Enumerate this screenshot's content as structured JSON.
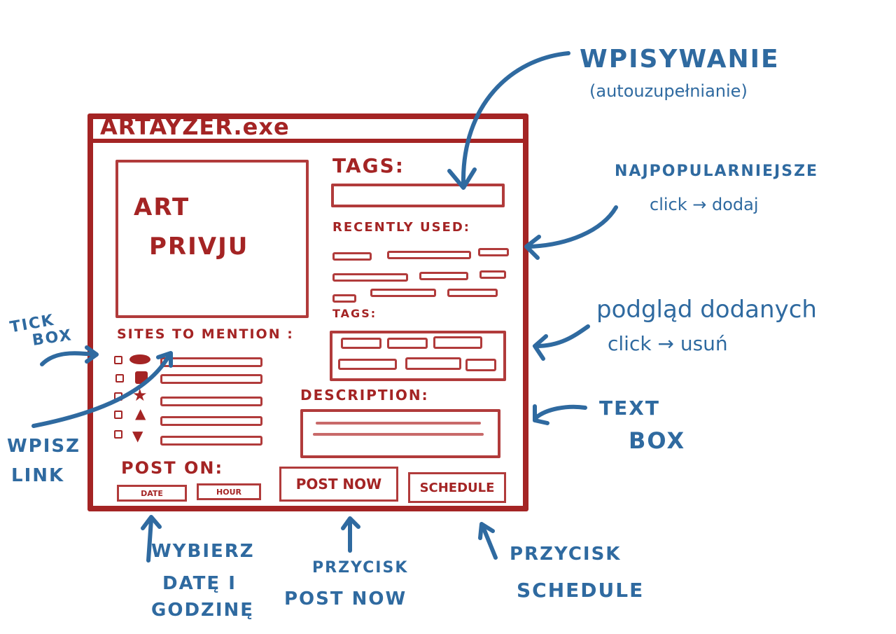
{
  "window": {
    "title": "ARTAYZER.exe",
    "preview_text": [
      "ART",
      "PRIVJU"
    ],
    "tags_label": "TAGS:",
    "recently_used_label": "RECENTLY USED:",
    "tags_selected_label": "TAGS:",
    "sites_label": "SITES TO MENTION :",
    "description_label": "DESCRIPTION:",
    "post_on_label": "POST ON:",
    "date_button": "DATE",
    "hour_button": "HOUR",
    "post_now_button": "POST NOW",
    "schedule_button": "SCHEDULE",
    "site_icons": [
      "circle",
      "square",
      "star",
      "triangle-up",
      "triangle-down"
    ]
  },
  "annotations": {
    "wpisywanie": {
      "title": "WPISYWANIE",
      "sub": "(autouzupełnianie)"
    },
    "najpopularniejsze": [
      "NAJPOPULARNIEJSZE",
      "click → dodaj"
    ],
    "podglad": [
      "podgląd dodanych",
      "click → usuń"
    ],
    "text_box": [
      "TEXT",
      "BOX"
    ],
    "tick_box": [
      "TICK",
      "BOX"
    ],
    "wpisz_link": [
      "WPISZ",
      "LINK"
    ],
    "wybierz": [
      "WYBIERZ",
      "DATĘ I",
      "GODZINĘ"
    ],
    "przycisk_post_now": [
      "PRZYCISK",
      "POST NOW"
    ],
    "przycisk_schedule": [
      "PRZYCISK",
      "SCHEDULE"
    ]
  },
  "colors": {
    "sketch_red": "#a42424",
    "annotation_blue": "#2f6aa0"
  }
}
